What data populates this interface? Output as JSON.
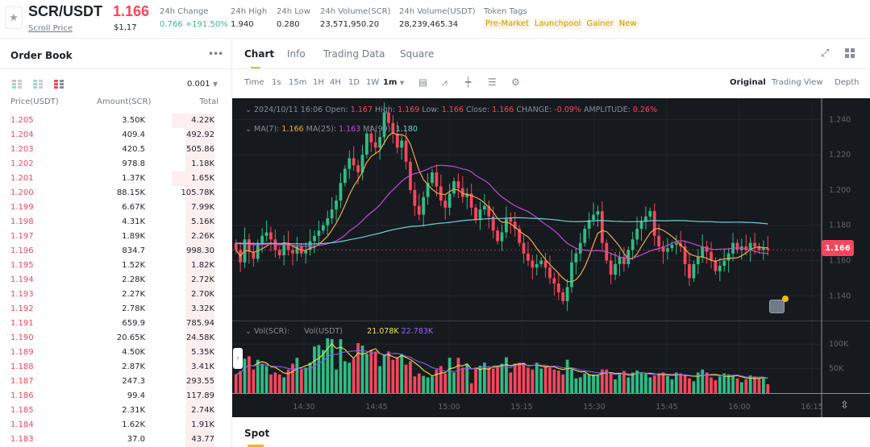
{
  "header": {
    "pair": "SCR/USDT",
    "subtitle_link": "Scroll Price",
    "last_price": "1.166",
    "last_price_usd": "$1,17",
    "stats": [
      {
        "label": "24h Change",
        "value": "0.766 +191.50%"
      },
      {
        "label": "24h High",
        "value": "1.940"
      },
      {
        "label": "24h Low",
        "value": "0.280"
      },
      {
        "label": "24h Volume(SCR)",
        "value": "23,571,950.20"
      },
      {
        "label": "24h Volume(USDT)",
        "value": "28,239,465.34"
      }
    ],
    "token_tags_label": "Token Tags",
    "token_tags": [
      "Pre-Market",
      "Launchpool",
      "Gainer",
      "New"
    ]
  },
  "order_book": {
    "title": "Order Book",
    "more_icon": "more-dots-icon",
    "precision": "0.001",
    "columns": [
      "Price(USDT)",
      "Amount(SCR)",
      "Total"
    ],
    "asks": [
      {
        "price": "1.205",
        "amount": "3.50K",
        "total": "4.22K",
        "depth": 0.22
      },
      {
        "price": "1.204",
        "amount": "409.4",
        "total": "492.92",
        "depth": 0.15
      },
      {
        "price": "1.203",
        "amount": "420.5",
        "total": "505.86",
        "depth": 0.15
      },
      {
        "price": "1.202",
        "amount": "978.8",
        "total": "1.18K",
        "depth": 0.15
      },
      {
        "price": "1.201",
        "amount": "1.37K",
        "total": "1.65K",
        "depth": 0.22
      },
      {
        "price": "1.200",
        "amount": "88.15K",
        "total": "105.78K",
        "depth": 0.15
      },
      {
        "price": "1.199",
        "amount": "6.67K",
        "total": "7.99K",
        "depth": 0.15
      },
      {
        "price": "1.198",
        "amount": "4.31K",
        "total": "5.16K",
        "depth": 0.15
      },
      {
        "price": "1.197",
        "amount": "1.89K",
        "total": "2.26K",
        "depth": 0.15
      },
      {
        "price": "1.196",
        "amount": "834.7",
        "total": "998.30",
        "depth": 0.15
      },
      {
        "price": "1.195",
        "amount": "1.52K",
        "total": "1.82K",
        "depth": 0.15
      },
      {
        "price": "1.194",
        "amount": "2.28K",
        "total": "2.72K",
        "depth": 0.15
      },
      {
        "price": "1.193",
        "amount": "2.27K",
        "total": "2.70K",
        "depth": 0.15
      },
      {
        "price": "1.192",
        "amount": "2.78K",
        "total": "3.32K",
        "depth": 0.15
      },
      {
        "price": "1.191",
        "amount": "659.9",
        "total": "785.94",
        "depth": 0.15
      },
      {
        "price": "1.190",
        "amount": "20.65K",
        "total": "24.58K",
        "depth": 0.15
      },
      {
        "price": "1.189",
        "amount": "4.50K",
        "total": "5.35K",
        "depth": 0.15
      },
      {
        "price": "1.188",
        "amount": "2.87K",
        "total": "3.41K",
        "depth": 0.15
      },
      {
        "price": "1.187",
        "amount": "247.3",
        "total": "293.55",
        "depth": 0.15
      },
      {
        "price": "1.186",
        "amount": "99.4",
        "total": "117.89",
        "depth": 0.15
      },
      {
        "price": "1.185",
        "amount": "2.31K",
        "total": "2.74K",
        "depth": 0.15
      },
      {
        "price": "1.184",
        "amount": "1.62K",
        "total": "1.91K",
        "depth": 0.15
      },
      {
        "price": "1.183",
        "amount": "37.0",
        "total": "43.77",
        "depth": 0.15
      }
    ]
  },
  "tabs": [
    "Chart",
    "Info",
    "Trading Data",
    "Square"
  ],
  "active_tab": "Chart",
  "toolbar": {
    "timeframes": [
      "Time",
      "1s",
      "15m",
      "1H",
      "4H",
      "1D",
      "1W",
      "1m"
    ],
    "active_timeframe": "1m",
    "views": [
      "Original",
      "Trading View",
      "Depth"
    ],
    "active_view": "Original"
  },
  "chart_legend": {
    "datetime": "2024/10/11 16:06",
    "open_label": "Open:",
    "open": "1.167",
    "high_label": "High:",
    "high": "1.169",
    "low_label": "Low:",
    "low": "1.166",
    "close_label": "Close:",
    "close": "1.166",
    "change_label": "CHANGE:",
    "change": "-0.09%",
    "amplitude_label": "AMPLITUDE:",
    "amplitude": "0.26%",
    "ma7_label": "MA(7):",
    "ma7": "1.166",
    "ma25_label": "MA(25):",
    "ma25": "1.163",
    "ma99_label": "MA(99):",
    "ma99": "1.180",
    "vol_scr_label": "Vol(SCR):",
    "vol_usdt_label": "Vol(USDT)",
    "vol_ma1": "21.078K",
    "vol_ma2": "22.783K"
  },
  "current_price_tag": "1.166",
  "spot_label": "Spot",
  "colors": {
    "up": "#2ebd85",
    "down": "#f6465d",
    "accent": "#f0b90b",
    "ma7": "#f0a84a",
    "ma25": "#c04bd3",
    "ma99": "#6ed0d6",
    "vol_ma1": "#f0e34a",
    "vol_ma2": "#8a5cf0"
  },
  "chart_data": {
    "type": "candlestick",
    "interval": "1m",
    "price_axis": {
      "ticks": [
        "1.240",
        "1.220",
        "1.200",
        "1.180",
        "1.160",
        "1.140"
      ],
      "range": [
        1.126,
        1.252
      ]
    },
    "volume_axis": {
      "ticks": [
        "100K",
        "50K"
      ],
      "range": [
        0,
        125000
      ]
    },
    "time_axis": {
      "ticks": [
        "14:30",
        "14:45",
        "15:00",
        "15:15",
        "15:30",
        "15:45",
        "16:00",
        "16:15"
      ]
    },
    "closes": [
      1.166,
      1.159,
      1.172,
      1.165,
      1.161,
      1.17,
      1.174,
      1.176,
      1.172,
      1.166,
      1.163,
      1.17,
      1.166,
      1.164,
      1.168,
      1.164,
      1.166,
      1.171,
      1.174,
      1.177,
      1.18,
      1.184,
      1.189,
      1.194,
      1.204,
      1.212,
      1.218,
      1.214,
      1.21,
      1.22,
      1.232,
      1.227,
      1.224,
      1.23,
      1.244,
      1.238,
      1.232,
      1.224,
      1.228,
      1.216,
      1.2,
      1.191,
      1.186,
      1.196,
      1.204,
      1.21,
      1.202,
      1.194,
      1.19,
      1.198,
      1.205,
      1.201,
      1.196,
      1.198,
      1.19,
      1.183,
      1.189,
      1.191,
      1.185,
      1.177,
      1.171,
      1.176,
      1.184,
      1.182,
      1.178,
      1.17,
      1.164,
      1.16,
      1.156,
      1.158,
      1.16,
      1.156,
      1.15,
      1.147,
      1.142,
      1.137,
      1.145,
      1.159,
      1.164,
      1.17,
      1.178,
      1.183,
      1.186,
      1.188,
      1.17,
      1.16,
      1.152,
      1.158,
      1.162,
      1.158,
      1.166,
      1.172,
      1.178,
      1.182,
      1.185,
      1.188,
      1.174,
      1.168,
      1.165,
      1.167,
      1.169,
      1.17,
      1.168,
      1.158,
      1.15,
      1.158,
      1.162,
      1.168,
      1.165,
      1.16,
      1.154,
      1.157,
      1.16,
      1.164,
      1.17,
      1.166,
      1.168,
      1.166,
      1.17,
      1.168,
      1.166,
      1.167,
      1.166
    ],
    "volumes": [
      38000,
      45000,
      70000,
      75000,
      48000,
      68000,
      60000,
      55000,
      38000,
      42000,
      38000,
      32000,
      48000,
      60000,
      72000,
      48000,
      52000,
      62000,
      95000,
      98000,
      88000,
      112000,
      110000,
      48000,
      110000,
      65000,
      62000,
      70000,
      102000,
      97000,
      80000,
      88000,
      85000,
      55000,
      78000,
      85000,
      68000,
      72000,
      80000,
      58000,
      65000,
      34000,
      40000,
      35000,
      32000,
      34000,
      48000,
      55000,
      40000,
      72000,
      42000,
      72000,
      52000,
      60000,
      20000,
      52000,
      56000,
      62000,
      52000,
      50000,
      55000,
      60000,
      73000,
      42000,
      60000,
      62000,
      62000,
      52000,
      48000,
      62000,
      50000,
      55000,
      52000,
      48000,
      46000,
      38000,
      68000,
      48000,
      30000,
      32000,
      40000,
      38000,
      38000,
      36000,
      48000,
      48000,
      40000,
      28000,
      38000,
      45000,
      32000,
      42000,
      46000,
      42000,
      40000,
      32000,
      36000,
      40000,
      42000,
      35000,
      28000,
      42000,
      40000,
      36000,
      30000,
      24000,
      42000,
      48000,
      42000,
      32000,
      26000,
      34000,
      40000,
      38000,
      36000,
      30000,
      22000,
      28000,
      36000,
      34000,
      30000,
      32000,
      18000
    ]
  }
}
